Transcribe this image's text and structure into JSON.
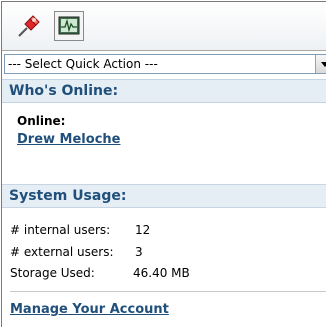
{
  "toolbar": {
    "pin_icon": "pushpin-icon",
    "monitor_icon": "system-monitor-icon"
  },
  "quick_action": {
    "selected": "--- Select Quick Action ---"
  },
  "whos_online": {
    "heading": "Who's Online:",
    "online_label": "Online:",
    "users": [
      "Drew Meloche"
    ]
  },
  "system_usage": {
    "heading": "System Usage:",
    "internal_label": "# internal users:",
    "internal_value": "12",
    "external_label": "# external users:",
    "external_value": "3",
    "storage_label": "Storage Used:",
    "storage_value": "46.40 MB"
  },
  "manage_account": "Manage Your Account",
  "colors": {
    "heading_text": "#1f4f7a",
    "heading_bg": "#e6eef5",
    "link": "#1f4f7a"
  }
}
